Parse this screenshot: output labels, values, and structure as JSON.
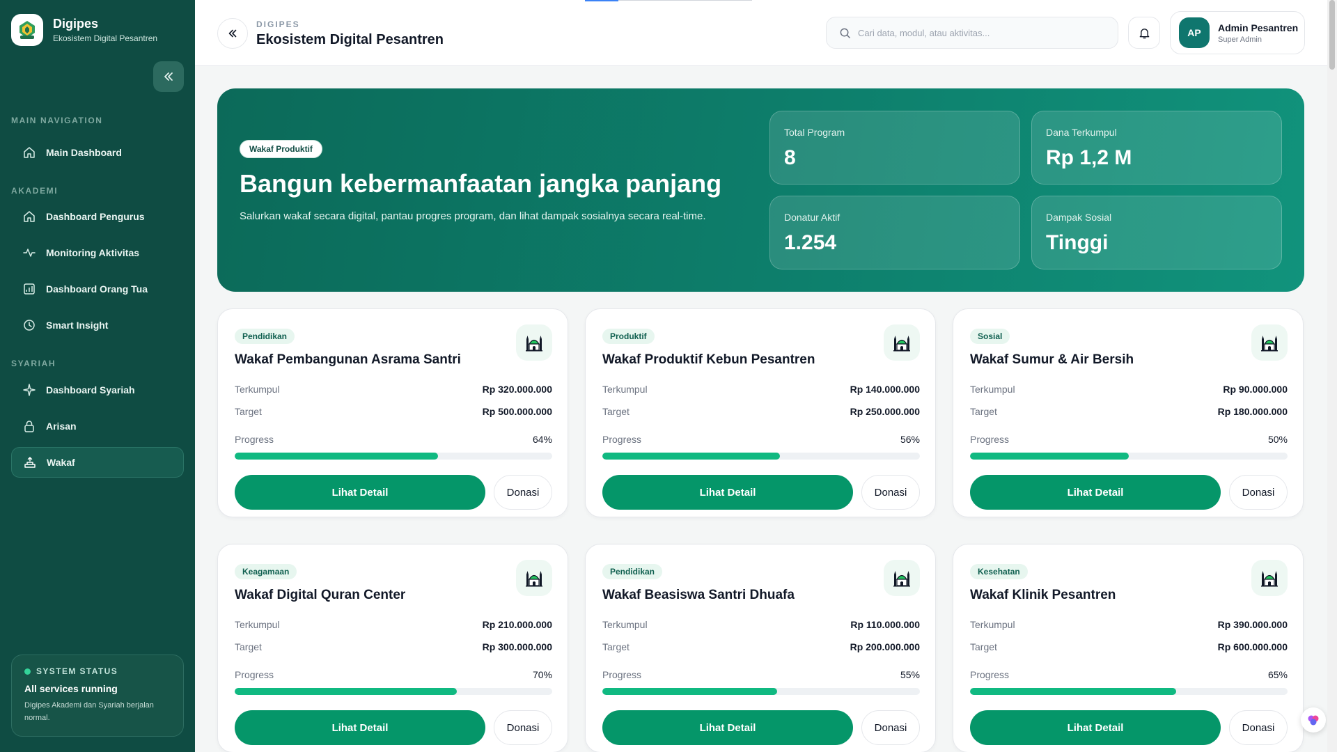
{
  "brand": {
    "name": "Digipes",
    "subtitle": "Ekosistem Digital Pesantren",
    "logo_text": "DIGIPES",
    "icon": "digipes-logo"
  },
  "sidebar": {
    "sections": [
      {
        "title": "MAIN NAVIGATION",
        "items": [
          {
            "label": "Main Dashboard",
            "icon": "home-icon"
          }
        ]
      },
      {
        "title": "AKADEMI",
        "items": [
          {
            "label": "Dashboard Pengurus",
            "icon": "home-icon"
          },
          {
            "label": "Monitoring Aktivitas",
            "icon": "activity-icon"
          },
          {
            "label": "Dashboard Orang Tua",
            "icon": "chart-icon"
          },
          {
            "label": "Smart Insight",
            "icon": "clock-icon"
          }
        ]
      },
      {
        "title": "SYARIAH",
        "items": [
          {
            "label": "Dashboard Syariah",
            "icon": "sparkle-icon"
          },
          {
            "label": "Arisan",
            "icon": "lock-icon"
          },
          {
            "label": "Wakaf",
            "icon": "donation-icon",
            "active": true
          }
        ]
      }
    ],
    "status": {
      "heading": "SYSTEM STATUS",
      "title": "All services running",
      "description": "Digipes Akademi dan Syariah berjalan normal."
    }
  },
  "topbar": {
    "kicker": "DIGIPES",
    "title": "Ekosistem Digital Pesantren",
    "search_placeholder": "Cari data, modul, atau aktivitas...",
    "search_value": "",
    "user": {
      "initials": "AP",
      "name": "Admin Pesantren",
      "role": "Super Admin"
    }
  },
  "hero": {
    "badge": "Wakaf Produktif",
    "title": "Bangun kebermanfaatan jangka panjang",
    "description": "Salurkan wakaf secara digital, pantau progres program, dan lihat dampak sosialnya secara real-time.",
    "stats": [
      {
        "label": "Total Program",
        "value": "8"
      },
      {
        "label": "Dana Terkumpul",
        "value": "Rp 1,2 M"
      },
      {
        "label": "Donatur Aktif",
        "value": "1.254"
      },
      {
        "label": "Dampak Sosial",
        "value": "Tinggi"
      }
    ]
  },
  "labels": {
    "collected": "Terkumpul",
    "target": "Target",
    "progress": "Progress",
    "detail_button": "Lihat Detail",
    "donate_button": "Donasi"
  },
  "programs": [
    {
      "category": "Pendidikan",
      "title": "Wakaf Pembangunan Asrama Santri",
      "collected": "Rp 320.000.000",
      "target": "Rp 500.000.000",
      "progress_text": "64%",
      "progress": 64
    },
    {
      "category": "Produktif",
      "title": "Wakaf Produktif Kebun Pesantren",
      "collected": "Rp 140.000.000",
      "target": "Rp 250.000.000",
      "progress_text": "56%",
      "progress": 56
    },
    {
      "category": "Sosial",
      "title": "Wakaf Sumur & Air Bersih",
      "collected": "Rp 90.000.000",
      "target": "Rp 180.000.000",
      "progress_text": "50%",
      "progress": 50
    },
    {
      "category": "Keagamaan",
      "title": "Wakaf Digital Quran Center",
      "collected": "Rp 210.000.000",
      "target": "Rp 300.000.000",
      "progress_text": "70%",
      "progress": 70
    },
    {
      "category": "Pendidikan",
      "title": "Wakaf Beasiswa Santri Dhuafa",
      "collected": "Rp 110.000.000",
      "target": "Rp 200.000.000",
      "progress_text": "55%",
      "progress": 55
    },
    {
      "category": "Kesehatan",
      "title": "Wakaf Klinik Pesantren",
      "collected": "Rp 390.000.000",
      "target": "Rp 600.000.000",
      "progress_text": "65%",
      "progress": 65
    }
  ],
  "colors": {
    "sidebar": "#0f4c43",
    "accent": "#059669",
    "progress": "#10b981",
    "hero_start": "#0c6a59",
    "hero_end": "#11937c"
  }
}
